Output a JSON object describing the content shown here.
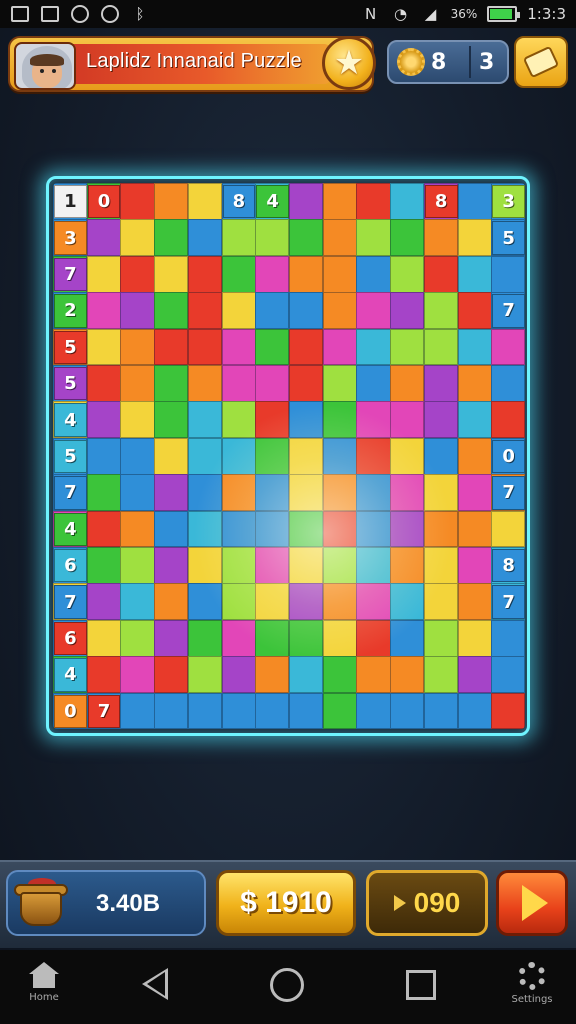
{
  "status_bar": {
    "battery_text": "36%",
    "time": "1:3:3",
    "icons": [
      "image-icon",
      "envelope-icon",
      "sync-icon",
      "face-icon",
      "bluetooth-icon",
      "vibrate-icon",
      "wifi-icon",
      "signal-icon",
      "battery-icon"
    ]
  },
  "header": {
    "title": "Laplidz Innanaid Puzzle",
    "coins_value": "8",
    "gems_value": "3",
    "icons": [
      "avatar",
      "star-icon",
      "gear-coin-icon",
      "ticket-icon"
    ]
  },
  "board": {
    "rows": 15,
    "cols": 14,
    "left_numbers": [
      "1",
      "3",
      "7",
      "2",
      "5",
      "5",
      "4",
      "5",
      "7",
      "4",
      "6",
      "7",
      "6",
      "4",
      "0"
    ],
    "top_numbers": [
      {
        "col": 1,
        "text": "0"
      },
      {
        "col": 5,
        "text": "8"
      },
      {
        "col": 6,
        "text": "4"
      },
      {
        "col": 11,
        "text": "8"
      },
      {
        "col": 13,
        "text": "3"
      }
    ],
    "right_numbers": [
      {
        "row": 1,
        "text": "5"
      },
      {
        "row": 3,
        "text": "7"
      },
      {
        "row": 7,
        "text": "0"
      },
      {
        "row": 8,
        "text": "7"
      },
      {
        "row": 10,
        "text": "8"
      },
      {
        "row": 11,
        "text": "7"
      }
    ],
    "extra_numbers": [
      {
        "row": 14,
        "col": 1,
        "text": "7"
      }
    ],
    "colors": {
      "blue": "#2f8fd8",
      "green": "#3cc43a",
      "red": "#e83a2a",
      "orange": "#f58a24",
      "yellow": "#f3d43a",
      "purple": "#a544c8",
      "magenta": "#e246b8",
      "cyan": "#3ab8d8",
      "lime": "#9fe040"
    },
    "frame_color": "#6ff4ff"
  },
  "bottom_bar": {
    "pot_value": "3.40B",
    "gold_value": "$ 1910",
    "score_value": "090",
    "icons": [
      "pot-icon",
      "play-icon"
    ]
  },
  "nav_bar": {
    "home_label": "Home",
    "settings_label": "Settings"
  }
}
